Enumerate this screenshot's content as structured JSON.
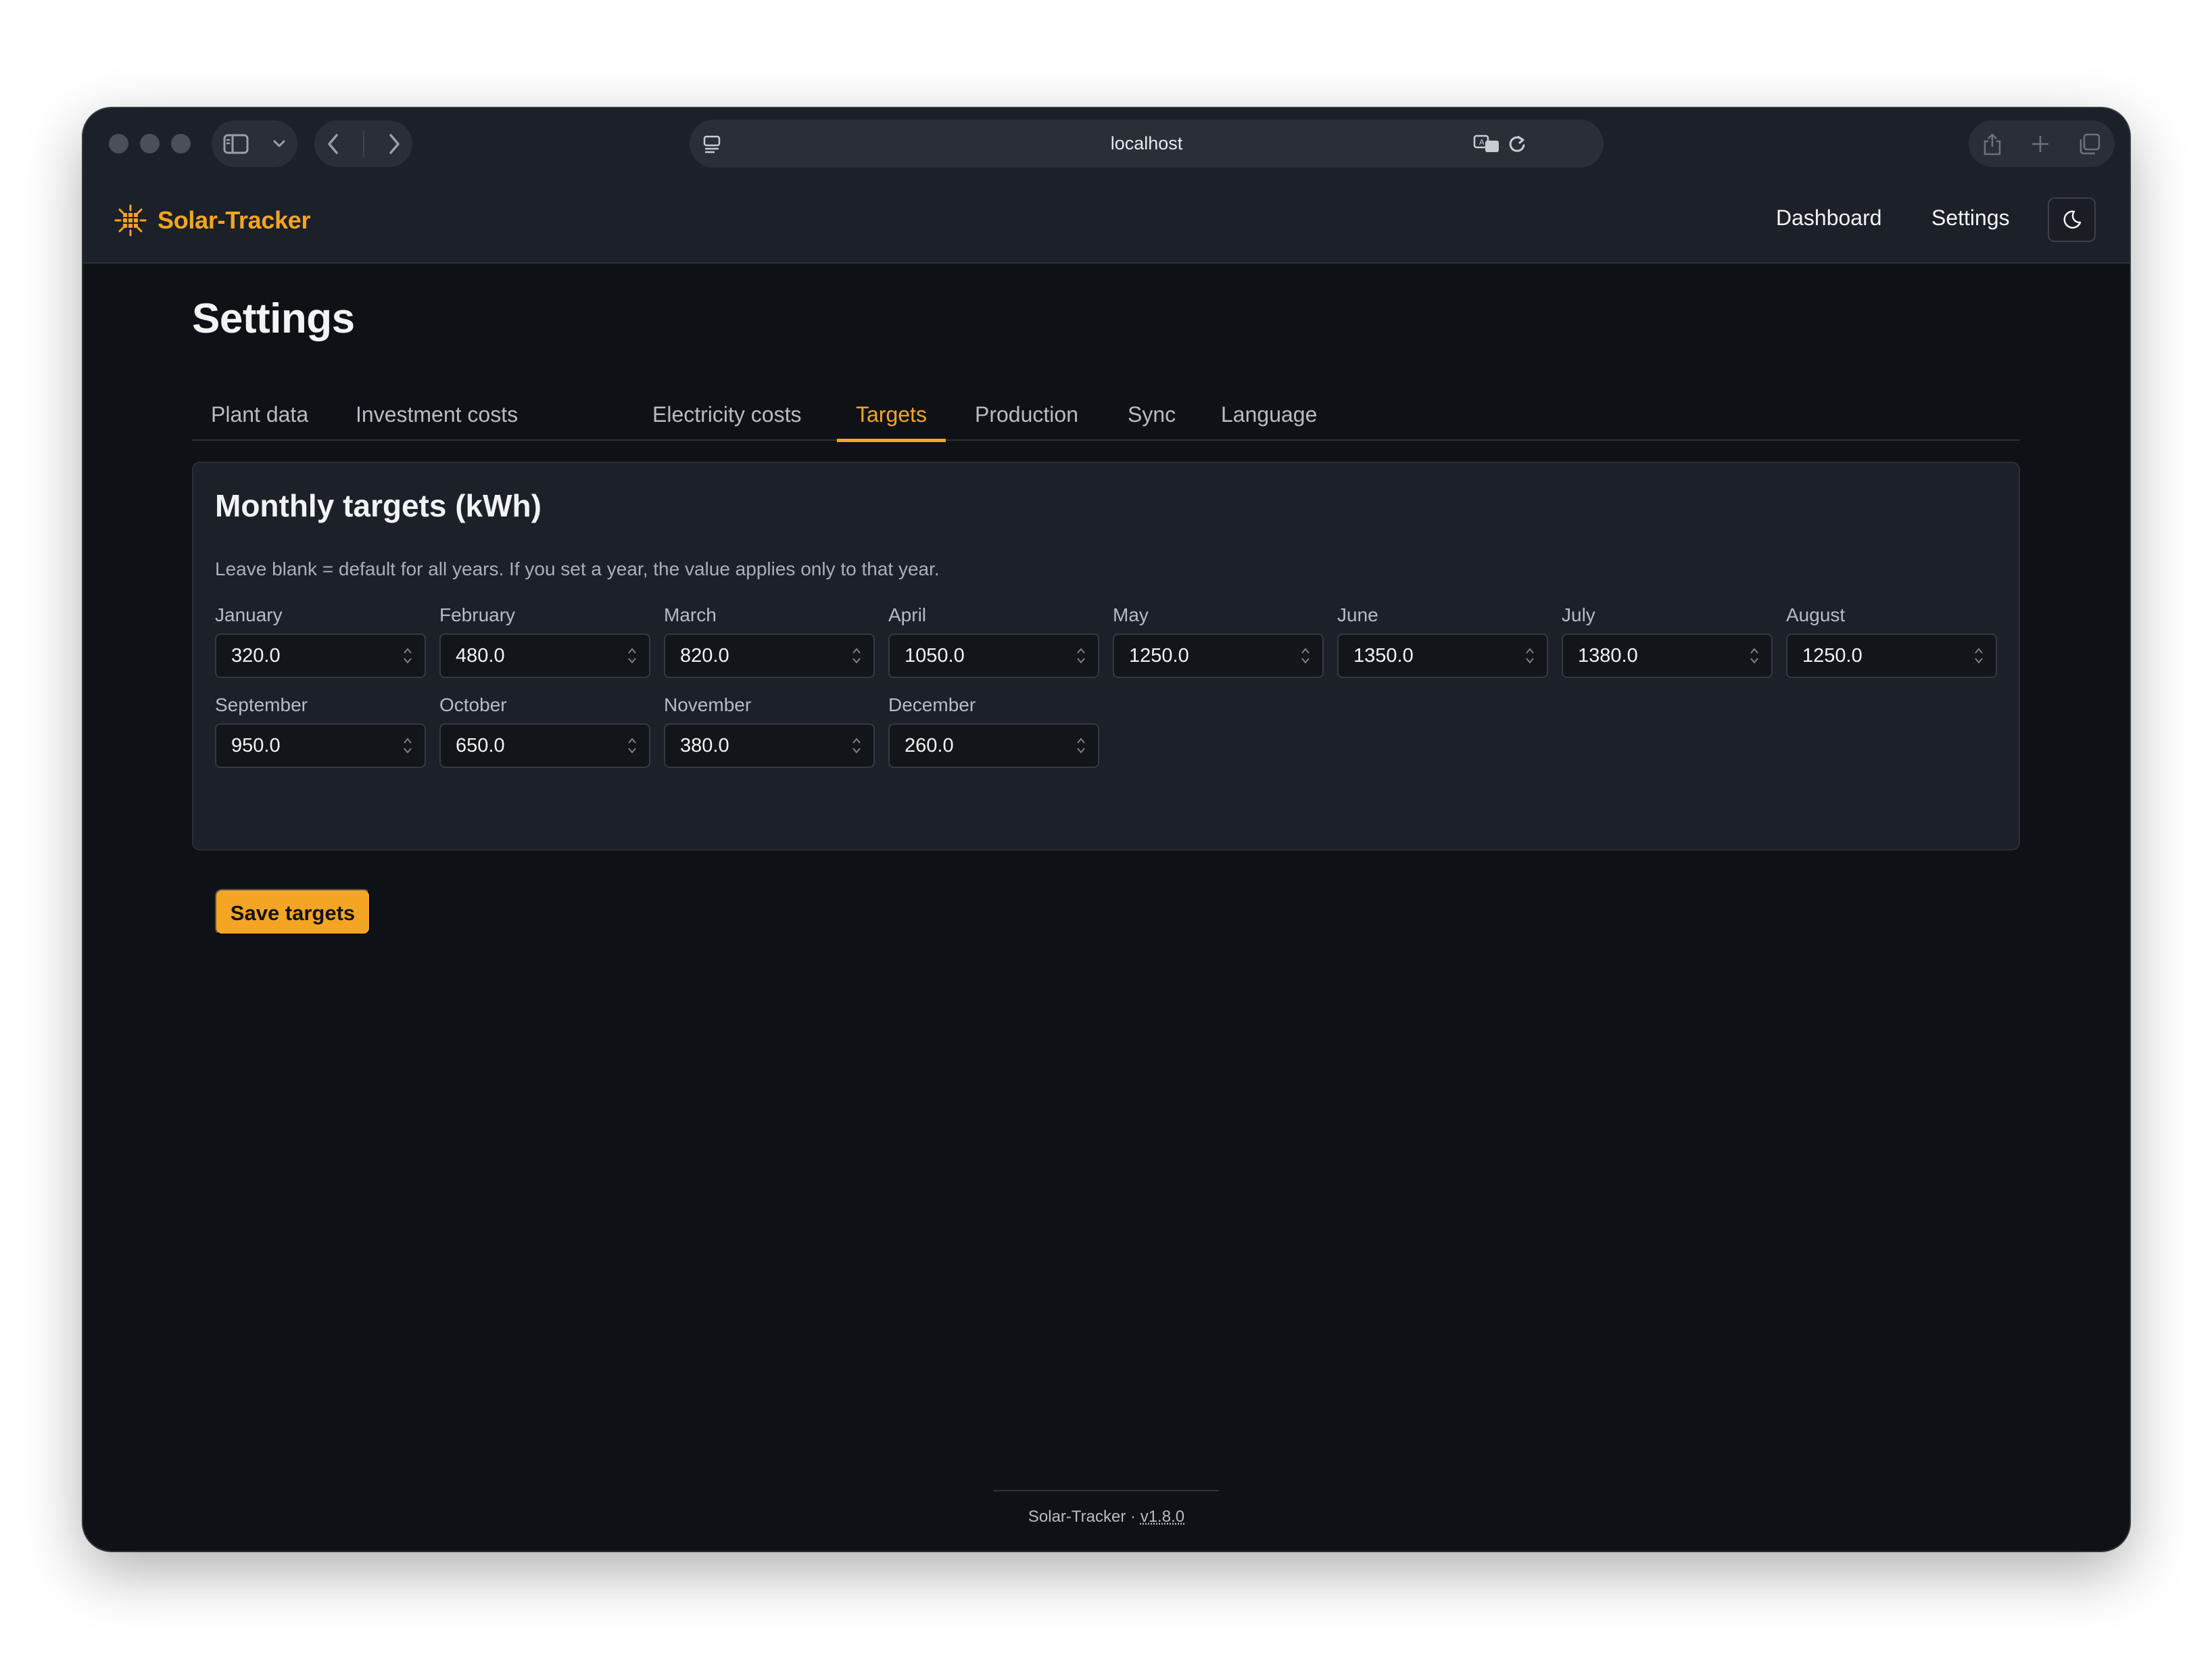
{
  "browser": {
    "url": "localhost"
  },
  "app": {
    "brand": "Solar-Tracker",
    "nav": {
      "dashboard": "Dashboard",
      "settings": "Settings"
    }
  },
  "page": {
    "title": "Settings",
    "tabs": [
      "Plant data",
      "Investment costs",
      "Electricity costs",
      "Targets",
      "Production",
      "Sync",
      "Language"
    ],
    "active_tab": "Targets"
  },
  "targets": {
    "title": "Monthly targets (kWh)",
    "hint": "Leave blank = default for all years. If you set a year, the value applies only to that year.",
    "months": [
      {
        "label": "January",
        "value": "320.0"
      },
      {
        "label": "February",
        "value": "480.0"
      },
      {
        "label": "March",
        "value": "820.0"
      },
      {
        "label": "April",
        "value": "1050.0"
      },
      {
        "label": "May",
        "value": "1250.0"
      },
      {
        "label": "June",
        "value": "1350.0"
      },
      {
        "label": "July",
        "value": "1380.0"
      },
      {
        "label": "August",
        "value": "1250.0"
      },
      {
        "label": "September",
        "value": "950.0"
      },
      {
        "label": "October",
        "value": "650.0"
      },
      {
        "label": "November",
        "value": "380.0"
      },
      {
        "label": "December",
        "value": "260.0"
      }
    ],
    "save_label": "Save targets"
  },
  "footer": {
    "app": "Solar-Tracker",
    "separator": "·",
    "version": "v1.8.0"
  },
  "colors": {
    "accent": "#f5a524",
    "background": "#0e1216",
    "surface": "#1c2028",
    "border": "#2b3038",
    "text": "#f1f3f5"
  },
  "icons": {
    "brand": "sun-grid-icon",
    "theme_toggle": "moon-icon",
    "sidebar": "sidebar-icon",
    "back": "chevron-left-icon",
    "forward": "chevron-right-icon",
    "share": "share-icon",
    "new_tab": "plus-icon",
    "tabs_overview": "tabs-overview-icon"
  }
}
